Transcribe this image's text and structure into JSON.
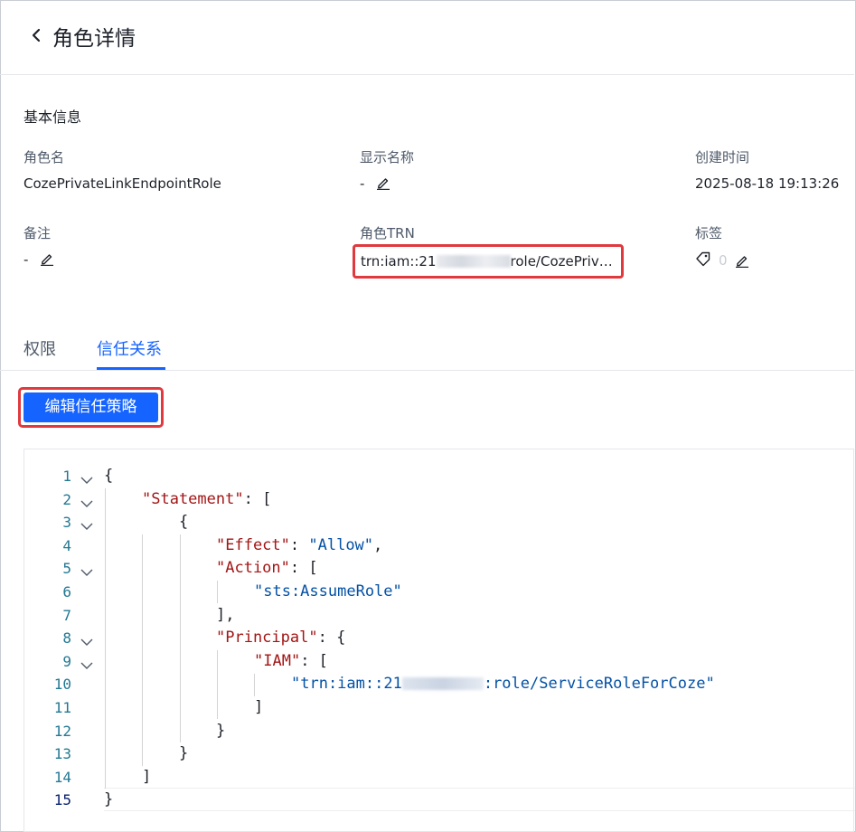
{
  "header": {
    "title": "角色详情"
  },
  "basic_info": {
    "section_title": "基本信息",
    "role_name_label": "角色名",
    "role_name_value": "CozePrivateLinkEndpointRole",
    "display_name_label": "显示名称",
    "display_name_value": "-",
    "created_label": "创建时间",
    "created_value": "2025-08-18 19:13:26",
    "remark_label": "备注",
    "remark_value": "-",
    "trn_label": "角色TRN",
    "trn_prefix": "trn:iam::21",
    "trn_suffix": "role/CozePrivate...",
    "tags_label": "标签",
    "tags_count": "0"
  },
  "tabs": [
    {
      "label": "权限",
      "active": false
    },
    {
      "label": "信任关系",
      "active": true
    }
  ],
  "actions": {
    "edit_trust_policy": "编辑信任策略"
  },
  "editor": {
    "lines": [
      {
        "n": "1"
      },
      {
        "n": "2"
      },
      {
        "n": "3"
      },
      {
        "n": "4"
      },
      {
        "n": "5"
      },
      {
        "n": "6"
      },
      {
        "n": "7"
      },
      {
        "n": "8"
      },
      {
        "n": "9"
      },
      {
        "n": "10"
      },
      {
        "n": "11"
      },
      {
        "n": "12"
      },
      {
        "n": "13"
      },
      {
        "n": "14"
      },
      {
        "n": "15"
      }
    ],
    "tokens": {
      "open_brace": "{",
      "statement_key": "\"Statement\"",
      "colon_bracket": ": [",
      "effect_key": "\"Effect\"",
      "effect_val": "\"Allow\"",
      "action_key": "\"Action\"",
      "action_val": "\"sts:AssumeRole\"",
      "close_bracket_comma": "],",
      "principal_key": "\"Principal\"",
      "colon_brace": ": {",
      "iam_key": "\"IAM\"",
      "trn_prefix": "\"trn:iam::21",
      "trn_suffix": ":role/ServiceRoleForCoze\"",
      "close_bracket": "]",
      "close_brace": "}"
    }
  },
  "colors": {
    "accent": "#1664ff",
    "highlight_border": "#e0393e",
    "json_key": "#a31515",
    "json_string": "#0451a5",
    "line_number": "#237893"
  }
}
